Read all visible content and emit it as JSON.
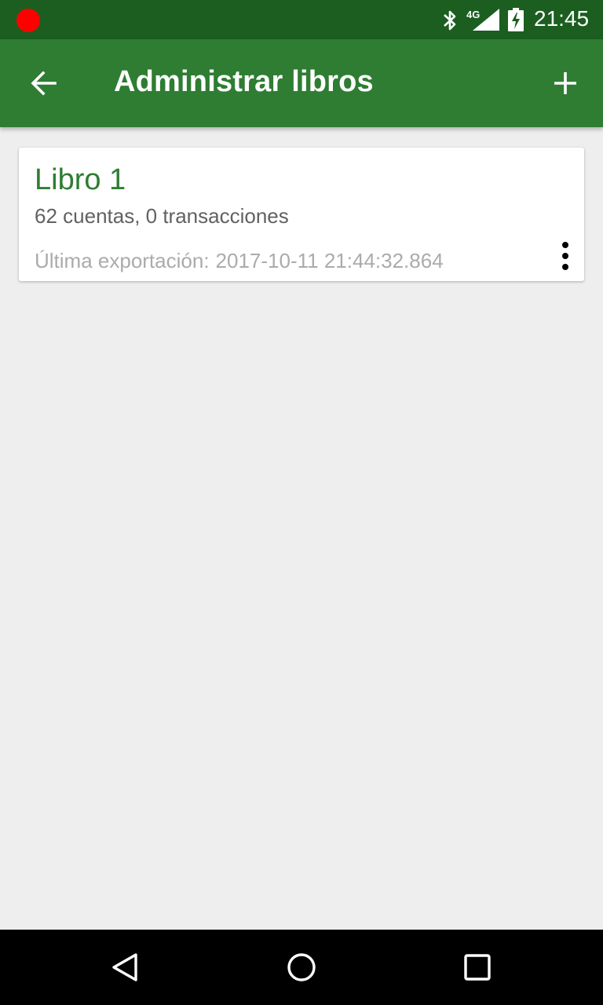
{
  "status_bar": {
    "network_type": "4G",
    "time": "21:45",
    "icons": [
      "recording-dot",
      "bluetooth-icon",
      "signal-icon",
      "battery-charging-icon"
    ]
  },
  "app_bar": {
    "title": "Administrar libros",
    "back_icon": "arrow-back-icon",
    "add_icon": "plus-icon",
    "color": "#2e7d32"
  },
  "books": [
    {
      "name": "Libro 1",
      "summary": "62 cuentas, 0 transacciones",
      "export_label": "Última exportación:",
      "export_value": "2017-10-11 21:44:32.864",
      "menu_icon": "more-vert-icon"
    }
  ],
  "nav_bar": {
    "icons": [
      "nav-back-icon",
      "nav-home-icon",
      "nav-recents-icon"
    ]
  },
  "colors": {
    "status_bar": "#1b5e20",
    "accent": "#2e7d32",
    "background": "#eeeeee",
    "recording": "#ff0000"
  }
}
